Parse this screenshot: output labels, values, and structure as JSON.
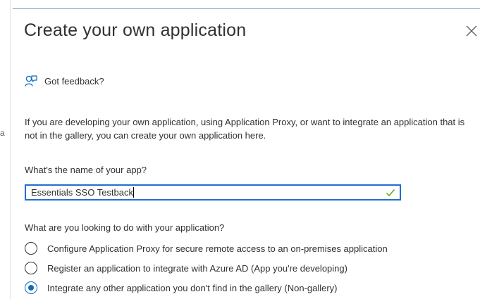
{
  "panel": {
    "title": "Create your own application",
    "close_icon": "close-icon"
  },
  "feedback": {
    "icon": "feedback-person-icon",
    "label": "Got feedback?"
  },
  "description": "If you are developing your own application, using Application Proxy, or want to integrate an application that is not in the gallery, you can create your own application here.",
  "stray_char": "a",
  "app_name_field": {
    "label": "What's the name of your app?",
    "value": "Essentials SSO Testback",
    "valid_icon": "checkmark-icon"
  },
  "intent": {
    "question": "What are you looking to do with your application?",
    "options": [
      {
        "label": "Configure Application Proxy for secure remote access to an on-premises application",
        "selected": false
      },
      {
        "label": "Register an application to integrate with Azure AD (App you're developing)",
        "selected": false
      },
      {
        "label": "Integrate any other application you don't find in the gallery (Non-gallery)",
        "selected": true
      }
    ]
  },
  "colors": {
    "accent": "#0f6cbd",
    "input_border": "#1f6fd0",
    "valid_check": "#57a300",
    "text": "#323130"
  }
}
